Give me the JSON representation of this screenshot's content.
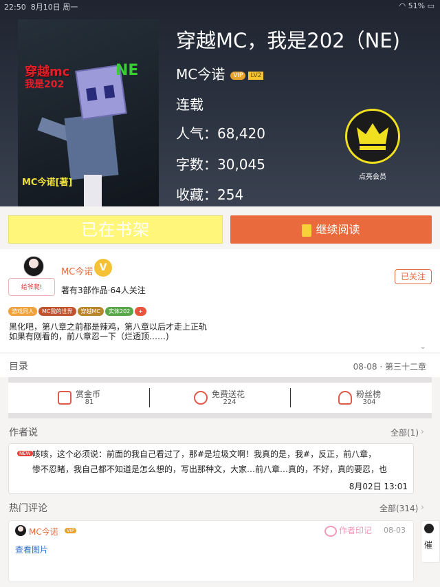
{
  "status_bar": {
    "time": "22:50",
    "date": "8月10日 周一",
    "battery": "51%"
  },
  "book": {
    "title": "穿越MC，我是202（NE)",
    "author": "MC今诺",
    "vip_badge": "VIP",
    "level_badge": "LV2",
    "status": "连载",
    "popularity": "人气：68,420",
    "word_count": "字数：30,045",
    "favorites": "收藏：254",
    "cover": {
      "title_line1": "穿越mc",
      "title_line2": "我是202",
      "tag": "NE",
      "author": "MC今诺[著]"
    }
  },
  "member": {
    "label": "点亮会员",
    "icon": "crown-icon"
  },
  "actions": {
    "shelf_label": "已在书架",
    "read_label": "继续阅读"
  },
  "author_info": {
    "name": "MC今诺",
    "v_badge": "V",
    "gift_label": "给爷爬!",
    "info": "著有3部作品·64人关注",
    "follow_label": "已关注"
  },
  "tags": [
    {
      "label": "游戏同人",
      "color": "#f0a23a"
    },
    {
      "label": "MC我的世界",
      "color": "#c0522e"
    },
    {
      "label": "穿越MC",
      "color": "#b8862a"
    },
    {
      "label": "实体202",
      "color": "#58a84a"
    },
    {
      "label": "+",
      "color": "#e8553a"
    }
  ],
  "description": "黑化吧，第八章之前都是辣鸡，第八章以后才走上正轨\n如果有刚看的，前八章忍一下（烂透顶……)",
  "toc": {
    "label": "目录",
    "latest": "08-08 · 第三十二章"
  },
  "rewards": [
    {
      "label": "赏金币",
      "count": "81",
      "icon": "coin-icon"
    },
    {
      "label": "免费送花",
      "count": "224",
      "icon": "flower-icon"
    },
    {
      "label": "粉丝榜",
      "count": "304",
      "icon": "medal-icon"
    }
  ],
  "author_says": {
    "label": "作者说",
    "all_label": "全部(1)",
    "new_tag": "NEW",
    "text": "咳咳，这个必须说：前面的我自己看过了，那#是垃圾文啊！我真的是，我#，反正，前八章，\n惨不忍睹，我自己都不知道是怎么想的，写出那种文，大家…前八章…真的，不好，真的要忍，也",
    "date": "8月02日  13:01"
  },
  "comments": {
    "label": "热门评论",
    "all_label": "全部(314)",
    "items": [
      {
        "name": "MC今诺",
        "vip": "VIP",
        "mark": "作者印记",
        "date": "08-03",
        "link": "查看图片"
      }
    ],
    "peek_text": "催"
  }
}
